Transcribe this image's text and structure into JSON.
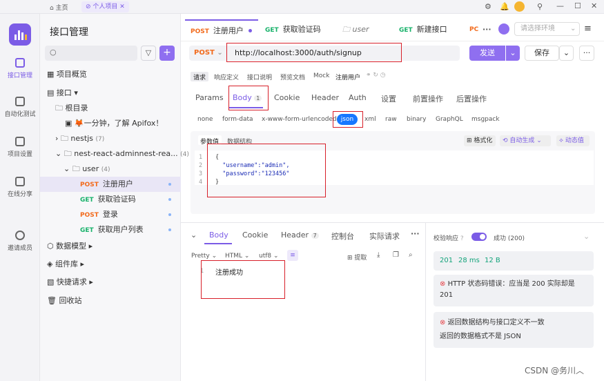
{
  "topbar": {
    "home": "主页",
    "project_tab": "个人项目"
  },
  "rail": [
    {
      "label": "接口管理"
    },
    {
      "label": "自动化测试"
    },
    {
      "label": "项目设置"
    },
    {
      "label": "在线分享"
    },
    {
      "label": "邀请成员"
    }
  ],
  "sidebar": {
    "title": "接口管理",
    "overview": "项目概览",
    "api": "接口",
    "root": "根目录",
    "intro": "🦊一分钟，了解 Apifox！",
    "nestjs": "nestjs",
    "nestjs_count": "(7)",
    "nest_react": "nest-react-adminnest-rea...",
    "nest_react_count": "(4)",
    "user": "user",
    "user_count": "(4)",
    "endpoints": [
      {
        "method": "POST",
        "name": "注册用户"
      },
      {
        "method": "GET",
        "name": "获取验证码"
      },
      {
        "method": "POST",
        "name": "登录"
      },
      {
        "method": "GET",
        "name": "获取用户列表"
      }
    ],
    "models": "数据模型",
    "components": "组件库",
    "quick": "快捷请求",
    "trash": "回收站"
  },
  "tabs": [
    {
      "method": "POST",
      "name": "注册用户"
    },
    {
      "method": "GET",
      "name": "获取验证码"
    },
    {
      "method": "",
      "name": "user"
    },
    {
      "method": "GET",
      "name": "新建接口"
    },
    {
      "method": "PC",
      "name": ""
    }
  ],
  "env": "请选择环境",
  "request": {
    "method": "POST",
    "url": "http://localhost:3000/auth/signup",
    "send": "发送",
    "save": "保存"
  },
  "mode_tabs": [
    "请求",
    "响应定义",
    "接口说明",
    "预览文档",
    "Mock"
  ],
  "mode_name": "注册用户",
  "param_tabs": [
    "Params",
    "Body",
    "Cookie",
    "Header",
    "Auth",
    "设置",
    "前置操作",
    "后置操作"
  ],
  "body_badge": "1",
  "body_types": [
    "none",
    "form-data",
    "x-www-form-urlencoded",
    "json",
    "xml",
    "raw",
    "binary",
    "GraphQL",
    "msgpack"
  ],
  "body_sub": {
    "value": "参数值",
    "schema": "数据结构",
    "format": "格式化",
    "autogen": "自动生成",
    "dynamic": "动态值"
  },
  "code_lines": [
    "{",
    "\"username\":\"admin\",",
    "\"password\":\"123456\"",
    "}"
  ],
  "resp_tabs": [
    "Body",
    "Cookie",
    "Header",
    "控制台",
    "实际请求"
  ],
  "header_badge": "7",
  "resp_opts": {
    "pretty": "Pretty",
    "html": "HTML",
    "enc": "utf8",
    "extract": "提取"
  },
  "resp_line": {
    "num": "1",
    "text": "注册成功"
  },
  "validate": {
    "label": "校验响应",
    "status": "成功 (200)"
  },
  "stats": {
    "code": "201",
    "time": "28 ms",
    "size": "12 B"
  },
  "errors": [
    {
      "text": "HTTP 状态码错误：应当是 200 实际却是 201"
    },
    {
      "text": "返回数据结构与接口定义不一致",
      "detail": "返回的数据格式不是 JSON"
    }
  ],
  "watermark": "CSDN @务川︿"
}
